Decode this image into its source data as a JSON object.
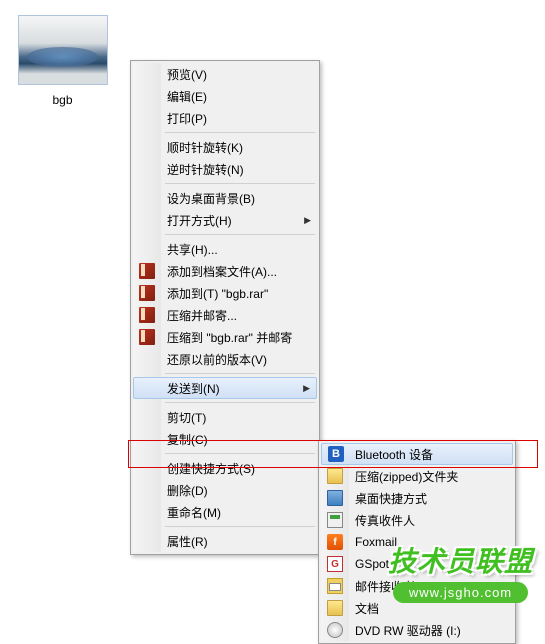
{
  "file": {
    "label": "bgb"
  },
  "menu": {
    "items": [
      {
        "label": "预览(V)",
        "icon": null,
        "arrow": false
      },
      {
        "label": "编辑(E)",
        "icon": null,
        "arrow": false
      },
      {
        "label": "打印(P)",
        "icon": null,
        "arrow": false
      },
      {
        "sep": true
      },
      {
        "label": "顺时针旋转(K)",
        "icon": null,
        "arrow": false
      },
      {
        "label": "逆时针旋转(N)",
        "icon": null,
        "arrow": false
      },
      {
        "sep": true
      },
      {
        "label": "设为桌面背景(B)",
        "icon": null,
        "arrow": false
      },
      {
        "label": "打开方式(H)",
        "icon": null,
        "arrow": true
      },
      {
        "sep": true
      },
      {
        "label": "共享(H)...",
        "icon": null,
        "arrow": false
      },
      {
        "label": "添加到档案文件(A)...",
        "icon": "books",
        "arrow": false
      },
      {
        "label": "添加到(T) \"bgb.rar\"",
        "icon": "books",
        "arrow": false
      },
      {
        "label": "压缩并邮寄...",
        "icon": "books",
        "arrow": false
      },
      {
        "label": "压缩到 \"bgb.rar\" 并邮寄",
        "icon": "books",
        "arrow": false
      },
      {
        "label": "还原以前的版本(V)",
        "icon": null,
        "arrow": false
      },
      {
        "sep": true
      },
      {
        "label": "发送到(N)",
        "icon": null,
        "arrow": true,
        "highlighted": true
      },
      {
        "sep": true
      },
      {
        "label": "剪切(T)",
        "icon": null,
        "arrow": false
      },
      {
        "label": "复制(C)",
        "icon": null,
        "arrow": false
      },
      {
        "sep": true
      },
      {
        "label": "创建快捷方式(S)",
        "icon": null,
        "arrow": false
      },
      {
        "label": "删除(D)",
        "icon": null,
        "arrow": false
      },
      {
        "label": "重命名(M)",
        "icon": null,
        "arrow": false
      },
      {
        "sep": true
      },
      {
        "label": "属性(R)",
        "icon": null,
        "arrow": false
      }
    ]
  },
  "submenu": {
    "items": [
      {
        "label": "Bluetooth 设备",
        "icon": "bluetooth",
        "highlighted": true
      },
      {
        "label": "压缩(zipped)文件夹",
        "icon": "folder"
      },
      {
        "label": "桌面快捷方式",
        "icon": "desktop"
      },
      {
        "label": "传真收件人",
        "icon": "fax"
      },
      {
        "label": "Foxmail",
        "icon": "foxmail"
      },
      {
        "label": "GSpot",
        "icon": "gspot"
      },
      {
        "label": "邮件接收者",
        "icon": "mail"
      },
      {
        "label": "文档",
        "icon": "docs"
      },
      {
        "label": "DVD RW 驱动器 (I:)",
        "icon": "dvd"
      }
    ]
  },
  "watermark": {
    "text": "技术员联盟",
    "url": "www.jsgho.com"
  }
}
